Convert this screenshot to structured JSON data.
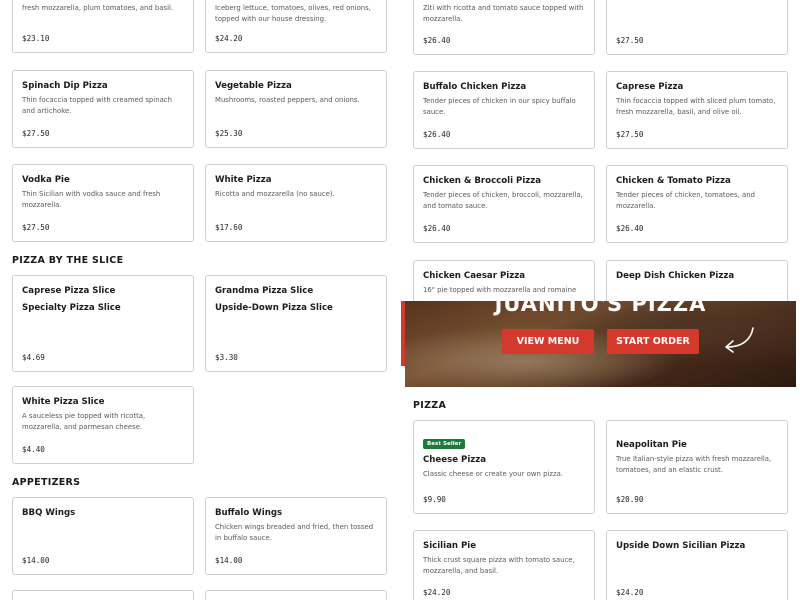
{
  "hero": {
    "title": "JUANITO'S PIZZA",
    "view_menu": "VIEW MENU",
    "start_order": "START ORDER"
  },
  "sections": {
    "pizza_by_the_slice": "PIZZA BY THE SLICE",
    "appetizers": "APPETIZERS",
    "pizza": "PIZZA"
  },
  "left": {
    "top1": {
      "desc": "fresh mozzarella, plum tomatoes, and basil.",
      "price": "$23.10"
    },
    "top2": {
      "desc": "Iceberg lettuce, tomatoes, olives, red onions, topped with our house dressing.",
      "price": "$24.20"
    },
    "spinach": {
      "name": "Spinach Dip Pizza",
      "desc": "Thin focaccia topped with creamed spinach and artichoke.",
      "price": "$27.50"
    },
    "vegetable": {
      "name": "Vegetable Pizza",
      "desc": "Mushrooms, roasted peppers, and onions.",
      "price": "$25.30"
    },
    "vodka": {
      "name": "Vodka Pie",
      "desc": "Thin Sicilian with vodka sauce and fresh mozzarella.",
      "price": "$27.50"
    },
    "white": {
      "name": "White Pizza",
      "desc": "Ricotta and mozzarella (no sauce).",
      "price": "$17.60"
    },
    "caprese_slice": {
      "name": "Caprese Pizza Slice",
      "name2": "Specialty Pizza Slice",
      "price": "$4.69"
    },
    "grandma_slice": {
      "name": "Grandma Pizza Slice",
      "name2": "Upside-Down Pizza Slice",
      "price": "$3.30"
    },
    "white_slice": {
      "name": "White Pizza Slice",
      "desc": "A sauceless pie topped with ricotta, mozzarella, and parmesan cheese.",
      "price": "$4.40"
    },
    "bbq_wings": {
      "name": "BBQ Wings",
      "price": "$14.00"
    },
    "buffalo_wings": {
      "name": "Buffalo Wings",
      "desc": "Chicken wings breaded and fried, then tossed in buffalo sauce.",
      "price": "$14.00"
    }
  },
  "right": {
    "top1": {
      "desc": "Ziti with ricotta and tomato sauce topped with mozzarella.",
      "price": "$26.40"
    },
    "top2": {
      "price": "$27.50"
    },
    "buffalo_chicken": {
      "name": "Buffalo Chicken Pizza",
      "desc": "Tender pieces of chicken in our spicy buffalo sauce.",
      "price": "$26.40"
    },
    "caprese": {
      "name": "Caprese Pizza",
      "desc": "Thin focaccia topped with sliced plum tomato, fresh mozzarella, basil, and olive oil.",
      "price": "$27.50"
    },
    "chicken_broccoli": {
      "name": "Chicken & Broccoli Pizza",
      "desc": "Tender pieces of chicken, broccoli, mozzarella, and tomato sauce.",
      "price": "$26.40"
    },
    "chicken_tomato": {
      "name": "Chicken & Tomato Pizza",
      "desc": "Tender pieces of chicken, tomatoes, and mozzarella.",
      "price": "$26.40"
    },
    "chicken_caesar": {
      "name": "Chicken Caesar Pizza",
      "desc": "16\" pie topped with mozzarella and romaine"
    },
    "deep_dish": {
      "name": "Deep Dish Chicken Pizza"
    },
    "cheese": {
      "badge": "Best Seller",
      "name": "Cheese Pizza",
      "desc": "Classic cheese or create your own pizza.",
      "price": "$9.90"
    },
    "neapolitan": {
      "name": "Neapolitan Pie",
      "desc": "True Italian-style pizza with fresh mozzarella, tomatoes, and an elastic crust.",
      "price": "$20.90"
    },
    "sicilian": {
      "name": "Sicilian Pie",
      "desc": "Thick crust square pizza with tomato sauce, mozzarella, and basil.",
      "price": "$24.20"
    },
    "upside_down": {
      "name": "Upside Down Sicilian Pizza",
      "price": "$24.20"
    }
  },
  "colors": {
    "accent": "#d43a2c",
    "badge": "#1e7a3a"
  }
}
